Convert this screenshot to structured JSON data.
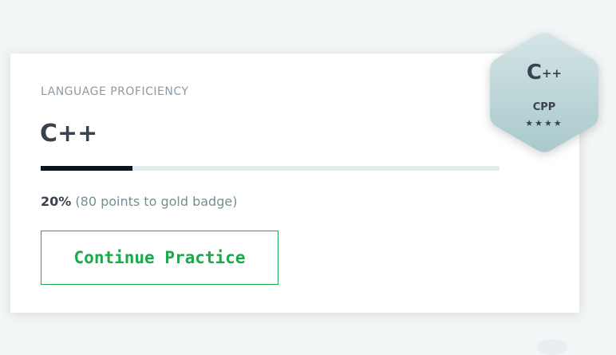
{
  "card": {
    "section_label": "LANGUAGE PROFICIENCY",
    "language_title": "C++",
    "progress": {
      "fraction": 0.2,
      "percent_label": "20%",
      "detail_text": "(80 points to gold badge)"
    },
    "continue_button_label": "Continue Practice"
  },
  "badge": {
    "icon_letter": "C",
    "icon_suffix": "++",
    "name": "CPP",
    "stars": "★★★★",
    "star_count": 4
  },
  "colors": {
    "page_background": "#f3f6f7",
    "title_text": "#39424e",
    "muted_text": "#8e9aa3",
    "progress_fill": "#0e141e",
    "progress_track": "#e4ecee",
    "accent_green": "#1ba94c",
    "badge_fill_top": "#d4e4e6",
    "badge_fill_bottom": "#a9c9cc"
  }
}
